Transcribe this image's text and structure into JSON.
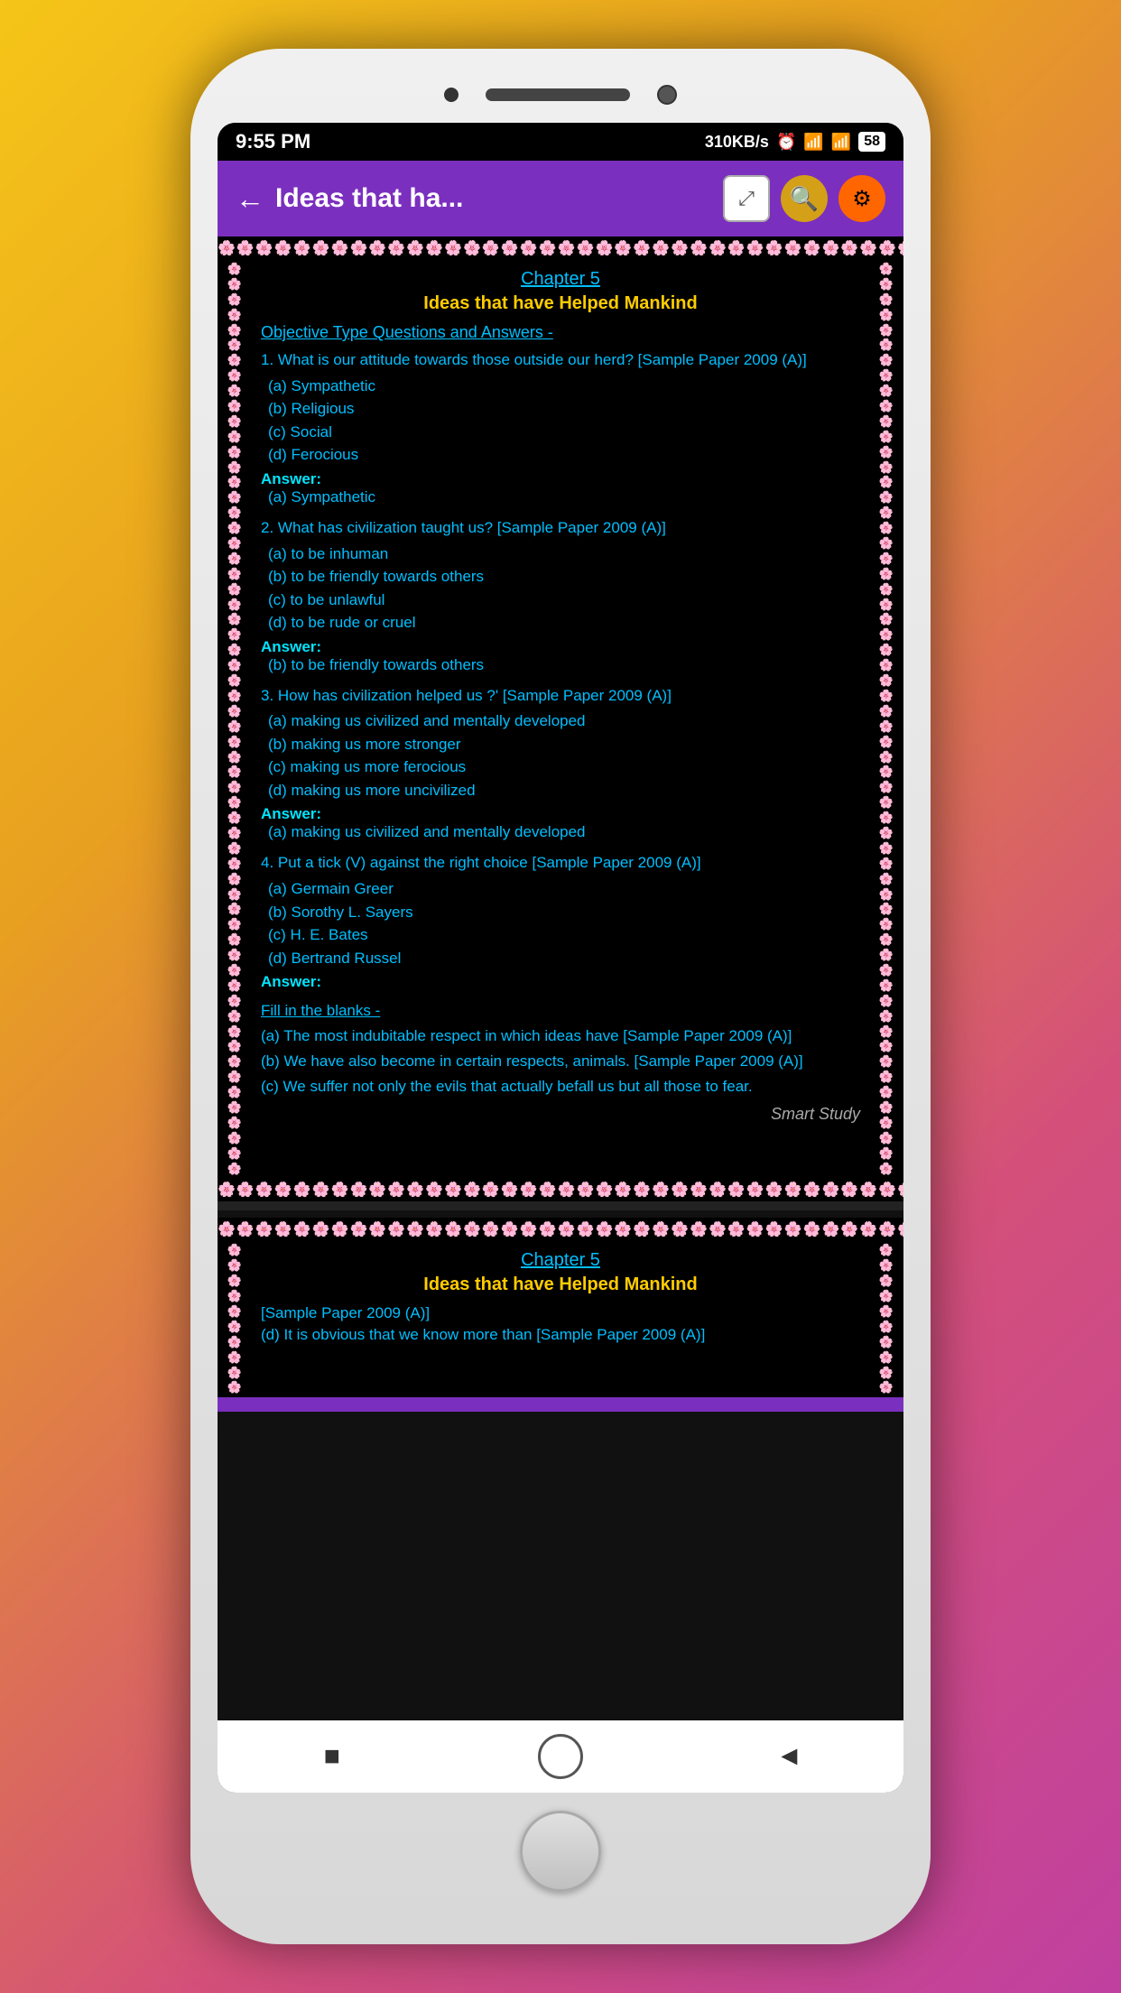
{
  "status_bar": {
    "time": "9:55 PM",
    "right_info": "310KB/s",
    "battery": "58"
  },
  "header": {
    "title": "Ideas that ha...",
    "back_label": "←",
    "expand_icon": "⤢",
    "search_icon": "🔍",
    "settings_icon": "⚙"
  },
  "page1": {
    "chapter": "Chapter 5",
    "book_title": "Ideas that have Helped Mankind",
    "section": "Objective Type Questions and Answers -",
    "questions": [
      {
        "q": "1. What is our attitude towards those outside our herd? [Sample Paper 2009 (A)]",
        "options": [
          "(a) Sympathetic",
          "(b) Religious",
          "(c) Social",
          "(d) Ferocious"
        ],
        "answer": "(a) Sympathetic"
      },
      {
        "q": "2. What has civilization taught us? [Sample Paper 2009 (A)]",
        "options": [
          "(a) to be inhuman",
          "(b) to be friendly towards others",
          "(c) to be unlawful",
          "(d) to be rude or cruel"
        ],
        "answer": "(b) to be friendly towards others"
      },
      {
        "q": "3. How has civilization helped us ?' [Sample Paper 2009 (A)]",
        "options": [
          "(a) making us civilized and mentally developed",
          "(b) making us more stronger",
          "(c) making us more ferocious",
          "(d) making us more uncivilized"
        ],
        "answer": "(a) making us civilized and mentally developed"
      },
      {
        "q": "4. Put a tick (V) against the right choice [Sample Paper 2009 (A)]",
        "options": [
          "(a) Germain Greer",
          "(b) Sorothy L. Sayers",
          "(c) H. E. Bates",
          "(d) Bertrand Russel"
        ],
        "answer": ""
      }
    ],
    "fill_blanks": {
      "heading": "Fill in the blanks -",
      "items": [
        "(a) The most indubitable respect in which ideas have [Sample Paper 2009 (A)]",
        "(b) We have also become in certain respects, animals. [Sample Paper 2009 (A)]",
        "(c) We suffer not only the evils that actually befall us but all those to fear."
      ]
    },
    "watermark": "Smart Study"
  },
  "page2": {
    "chapter": "Chapter 5",
    "book_title": "Ideas that have Helped Mankind",
    "sample_tag": "[Sample Paper 2009 (A)]",
    "partial_text": "(d) It is obvious that we know more than [Sample Paper 2009 (A)]"
  },
  "bottom_nav": {
    "stop_icon": "■",
    "home_icon": "○",
    "back_icon": "◄"
  },
  "flowers": "🌸🌸🌸🌸🌸🌸🌸🌸🌸🌸🌸🌸🌸🌸🌸🌸🌸🌸🌸🌸🌸🌸🌸🌸🌸🌸🌸🌸🌸🌸🌸🌸🌸🌸🌸🌸🌸🌸🌸🌸🌸🌸🌸🌸🌸🌸🌸🌸🌸🌸"
}
